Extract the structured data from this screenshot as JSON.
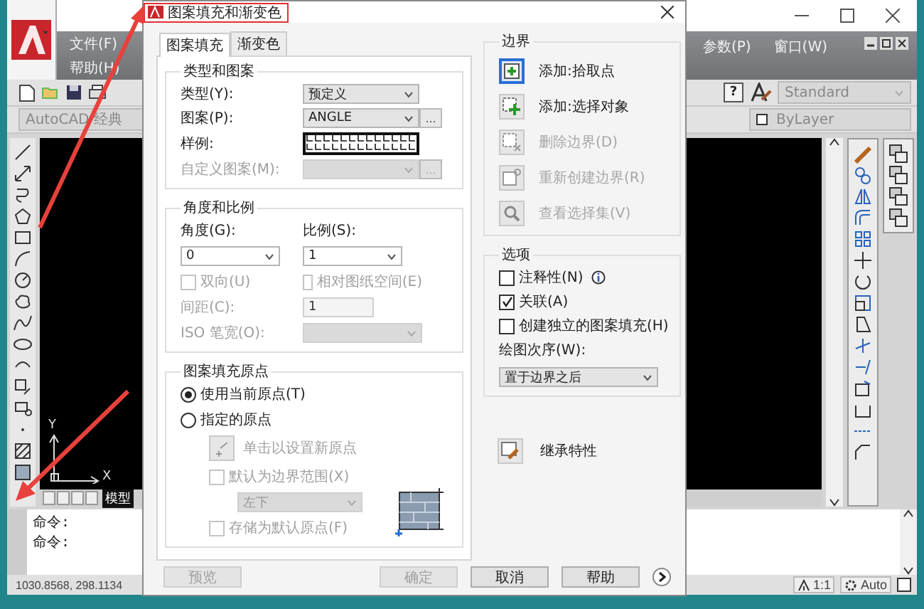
{
  "app": {
    "menu_left": [
      {
        "label": "文件(F)"
      },
      {
        "label": "帮助(H)"
      }
    ],
    "menu_right": [
      {
        "label": "参数(P)"
      },
      {
        "label": "窗口(W)"
      }
    ],
    "help_key": "?",
    "text_style": "Standard",
    "workspace": "AutoCAD 经典",
    "layer": "ByLayer",
    "ucs": {
      "y": "Y",
      "x": "X"
    },
    "model_tab": {
      "label": "模型",
      "selected": true
    },
    "command_lines": [
      "命令:",
      "命令:"
    ],
    "coordinates": "1030.8568, 298.1134",
    "annotation_scale": "1:1",
    "auto_label": "Auto"
  },
  "dialog": {
    "title": "图案填充和渐变色",
    "tabs": [
      {
        "label": "图案填充",
        "selected": true
      },
      {
        "label": "渐变色",
        "selected": false
      }
    ],
    "type_pattern": {
      "title": "类型和图案",
      "rows": [
        {
          "kind": "dropdown",
          "label": "类型(Y):",
          "value": "预定义",
          "disabled": false
        },
        {
          "kind": "dropdown_browse",
          "label": "图案(P):",
          "value": "ANGLE",
          "browse": "...",
          "disabled": false
        },
        {
          "kind": "swatch",
          "label": "样例:",
          "disabled": false
        },
        {
          "kind": "dropdown_browse",
          "label": "自定义图案(M):",
          "browse": "...",
          "disabled": true
        }
      ]
    },
    "angle_scale": {
      "title": "角度和比例",
      "angle": {
        "label": "角度(G):",
        "value": "0"
      },
      "scale": {
        "label": "比例(S):",
        "value": "1"
      },
      "checks": [
        {
          "label": "双向(U)",
          "checked": false,
          "disabled": true
        },
        {
          "label": "相对图纸空间(E)",
          "checked": false,
          "disabled": true
        }
      ],
      "spacing": {
        "label": "间距(C):",
        "value": "1",
        "disabled": true
      },
      "iso_pen": {
        "label": "ISO 笔宽(O):",
        "disabled": true
      }
    },
    "origin": {
      "title": "图案填充原点",
      "options": [
        {
          "label": "使用当前原点(T)",
          "selected": true
        },
        {
          "label": "指定的原点",
          "selected": false
        }
      ],
      "set_button": {
        "label": "单击以设置新原点",
        "disabled": true
      },
      "default_extent": {
        "label": "默认为边界范围(X)",
        "checked": false,
        "disabled": true
      },
      "position": {
        "value": "左下",
        "disabled": true
      },
      "store": {
        "label": "存储为默认原点(F)",
        "checked": false,
        "disabled": true
      }
    },
    "boundaries": {
      "title": "边界",
      "actions": [
        {
          "kind": "pick",
          "label": "添加:拾取点",
          "disabled": false,
          "focused": true
        },
        {
          "kind": "select",
          "label": "添加:选择对象",
          "disabled": false,
          "focused": false
        },
        {
          "kind": "remove",
          "label": "删除边界(D)",
          "disabled": true,
          "focused": false
        },
        {
          "kind": "recreate",
          "label": "重新创建边界(R)",
          "disabled": true,
          "focused": false
        },
        {
          "kind": "view",
          "label": "查看选择集(V)",
          "disabled": true,
          "focused": false
        }
      ]
    },
    "options": {
      "title": "选项",
      "checks": [
        {
          "label": "注释性(N)",
          "checked": false,
          "info": true
        },
        {
          "label": "关联(A)",
          "checked": true,
          "info": false
        },
        {
          "label": "创建独立的图案填充(H)",
          "checked": false,
          "info": false
        }
      ],
      "draw_order": {
        "label": "绘图次序(W):",
        "value": "置于边界之后"
      }
    },
    "inherit": {
      "label": "继承特性"
    },
    "buttons": [
      {
        "label": "预览",
        "disabled": true
      },
      {
        "label": "确定",
        "disabled": true
      },
      {
        "label": "取消",
        "disabled": false
      },
      {
        "label": "帮助",
        "disabled": false
      }
    ]
  }
}
